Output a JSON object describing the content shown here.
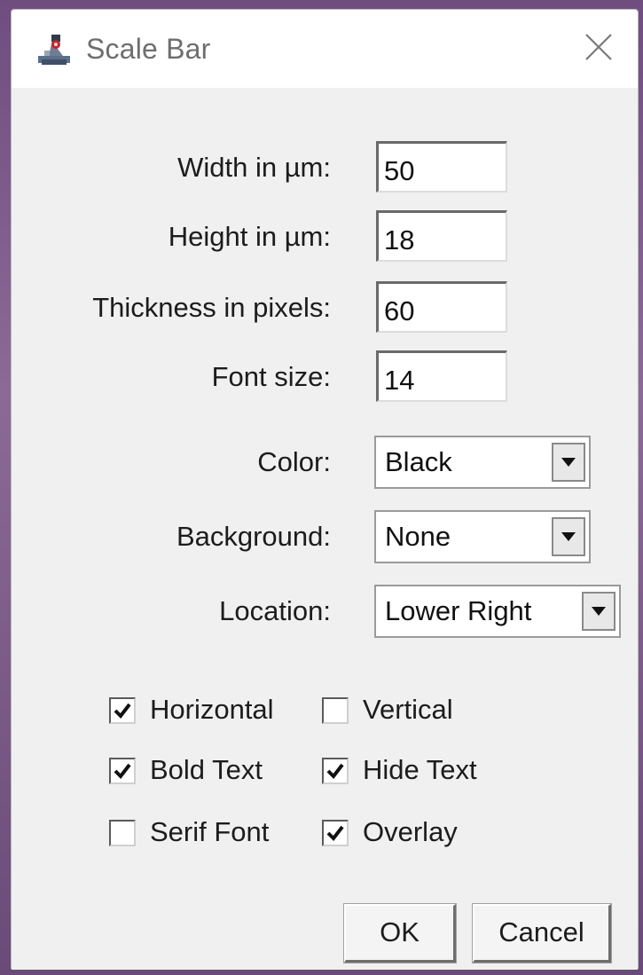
{
  "window": {
    "title": "Scale Bar",
    "icon": "imagej-microscope-icon",
    "close_icon": "close-icon"
  },
  "fields": [
    {
      "label": "Width in µm:",
      "value": "50"
    },
    {
      "label": "Height in µm:",
      "value": "18"
    },
    {
      "label": "Thickness in pixels:",
      "value": "60"
    },
    {
      "label": "Font size:",
      "value": "14"
    }
  ],
  "choices": [
    {
      "label": "Color:",
      "value": "Black"
    },
    {
      "label": "Background:",
      "value": "None"
    },
    {
      "label": "Location:",
      "value": "Lower Right"
    }
  ],
  "checkboxes": [
    {
      "label": "Horizontal",
      "checked": true
    },
    {
      "label": "Vertical",
      "checked": false
    },
    {
      "label": "Bold Text",
      "checked": true
    },
    {
      "label": "Hide Text",
      "checked": true
    },
    {
      "label": "Serif Font",
      "checked": false
    },
    {
      "label": "Overlay",
      "checked": true
    }
  ],
  "buttons": {
    "ok": "OK",
    "cancel": "Cancel"
  },
  "colors": {
    "dialog_bg": "#f0f0f0",
    "titlebar_bg": "#ffffff",
    "title_text": "#6e6e6e",
    "text": "#1c1c1c"
  }
}
